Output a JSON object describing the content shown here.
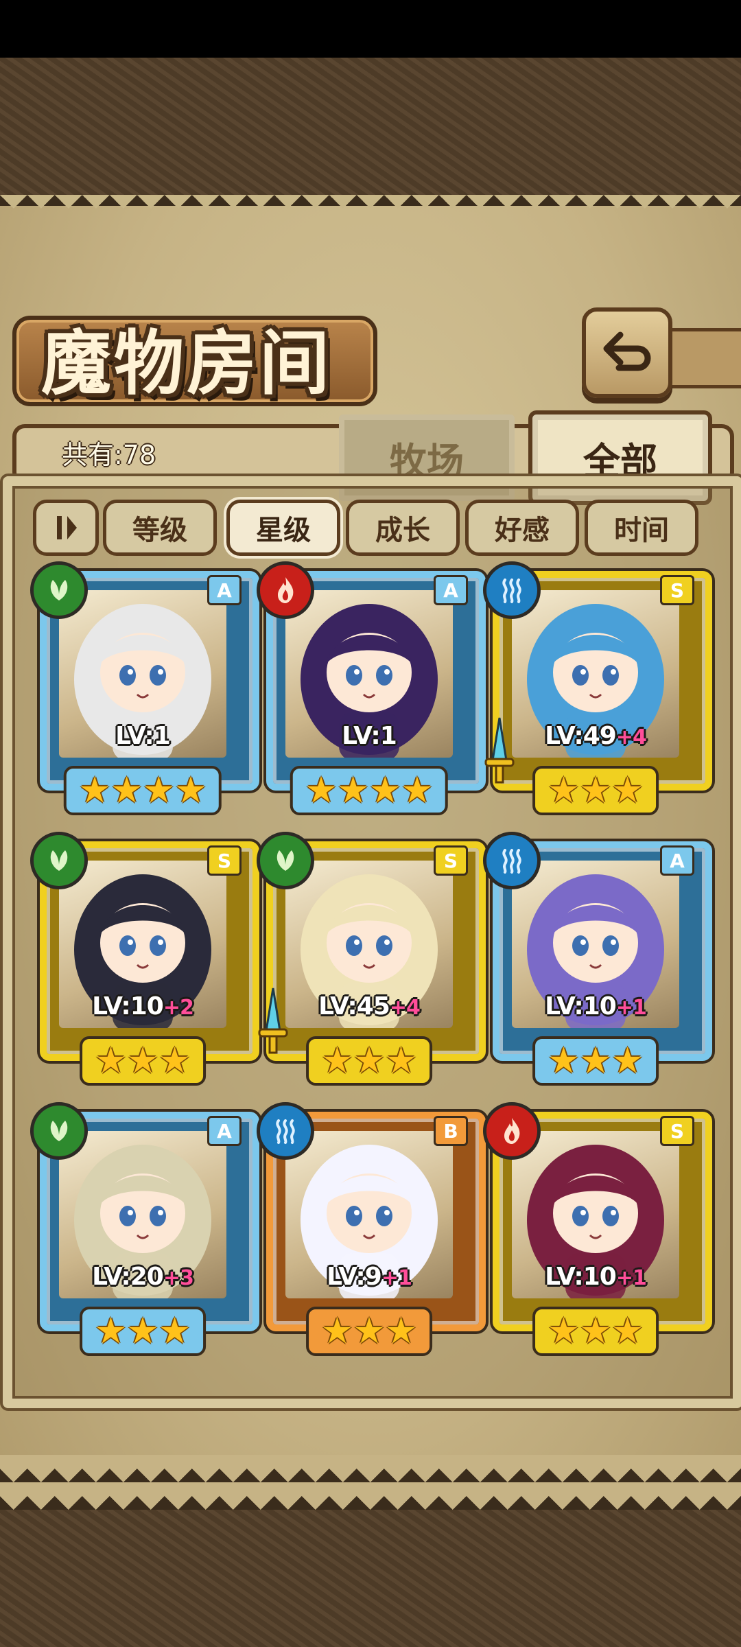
{
  "title": "魔物房间",
  "count_text": "共有:78",
  "tabs": {
    "farm": "牧场",
    "all": "全部"
  },
  "filters": [
    "等级",
    "星级",
    "成长",
    "好感",
    "时间"
  ],
  "active_filter": "星级",
  "colors": {
    "gold_frame": "#f0d020",
    "blue_frame": "#7cc8ec",
    "orange_frame": "#f29a3a",
    "star": "#ffc21a",
    "plus": "#ff4e9a"
  },
  "monsters": [
    {
      "element": "grass",
      "rank": "A",
      "level": "LV:1",
      "plus": "",
      "stars": "★★★★",
      "frame": "blue",
      "weapon": false
    },
    {
      "element": "fire",
      "rank": "A",
      "level": "LV:1",
      "plus": "",
      "stars": "★★★★",
      "frame": "blue",
      "weapon": false
    },
    {
      "element": "water",
      "rank": "S",
      "level": "LV:49",
      "plus": "+4",
      "stars": "★★★",
      "frame": "gold",
      "weapon": true
    },
    {
      "element": "grass",
      "rank": "S",
      "level": "LV:10",
      "plus": "+2",
      "stars": "★★★",
      "frame": "gold",
      "weapon": false
    },
    {
      "element": "grass",
      "rank": "S",
      "level": "LV:45",
      "plus": "+4",
      "stars": "★★★",
      "frame": "gold",
      "weapon": true
    },
    {
      "element": "water",
      "rank": "A",
      "level": "LV:10",
      "plus": "+1",
      "stars": "★★★",
      "frame": "blue",
      "weapon": false
    },
    {
      "element": "grass",
      "rank": "A",
      "level": "LV:20",
      "plus": "+3",
      "stars": "★★★",
      "frame": "blue",
      "weapon": false
    },
    {
      "element": "water",
      "rank": "B",
      "level": "LV:9",
      "plus": "+1",
      "stars": "★★★",
      "frame": "orange",
      "weapon": false
    },
    {
      "element": "fire",
      "rank": "S",
      "level": "LV:10",
      "plus": "+1",
      "stars": "★★★",
      "frame": "gold",
      "weapon": false
    }
  ]
}
